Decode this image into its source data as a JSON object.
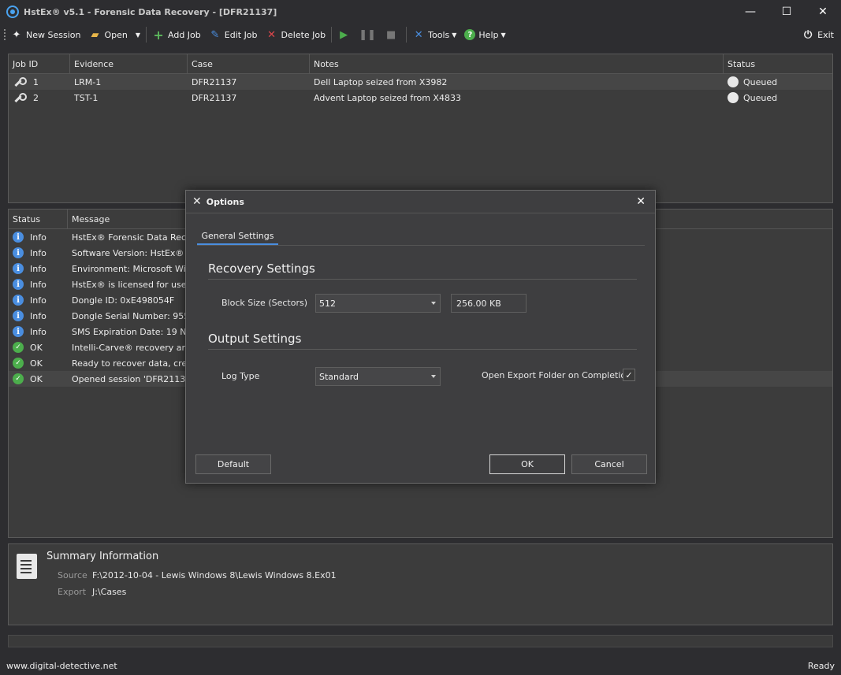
{
  "window": {
    "title": "HstEx® v5.1 - Forensic Data Recovery - [DFR21137]",
    "minimize": "—",
    "maximize": "☐",
    "close": "✕"
  },
  "toolbar": {
    "new_session": "New Session",
    "open": "Open",
    "add_job": "Add Job",
    "edit_job": "Edit Job",
    "delete_job": "Delete Job",
    "tools": "Tools",
    "help": "Help",
    "exit": "Exit"
  },
  "jobs": {
    "columns": [
      "Job ID",
      "Evidence",
      "Case",
      "Notes",
      "Status"
    ],
    "rows": [
      {
        "id": "1",
        "evidence": "LRM-1",
        "case": "DFR21137",
        "notes": "Dell Laptop seized from X3982",
        "status": "Queued"
      },
      {
        "id": "2",
        "evidence": "TST-1",
        "case": "DFR21137",
        "notes": "Advent Laptop seized from X4833",
        "status": "Queued"
      }
    ]
  },
  "log": {
    "columns": [
      "Status",
      "Message"
    ],
    "rows": [
      {
        "status": "Info",
        "message": "HstEx® Forensic Data Recove"
      },
      {
        "status": "Info",
        "message": "Software Version: HstEx® v5"
      },
      {
        "status": "Info",
        "message": "Environment: Microsoft Windo"
      },
      {
        "status": "Info",
        "message": "HstEx® is licensed for use by:"
      },
      {
        "status": "Info",
        "message": "Dongle ID: 0xE498054F"
      },
      {
        "status": "Info",
        "message": "Dongle Serial Number: 95521C"
      },
      {
        "status": "Info",
        "message": "SMS Expiration Date: 19 Nove"
      },
      {
        "status": "OK",
        "message": "Intelli-Carve® recovery and v"
      },
      {
        "status": "OK",
        "message": "Ready to recover data, create"
      },
      {
        "status": "OK",
        "message": "Opened session 'DFR21137'"
      }
    ]
  },
  "summary": {
    "title": "Summary Information",
    "source_label": "Source",
    "source_value": "F:\\2012-10-04 - Lewis Windows 8\\Lewis Windows 8.Ex01",
    "export_label": "Export",
    "export_value": "J:\\Cases"
  },
  "statusbar": {
    "left": "www.digital-detective.net",
    "right": "Ready"
  },
  "dialog": {
    "title": "Options",
    "close": "✕",
    "tab": "General Settings",
    "recovery_heading": "Recovery Settings",
    "block_size_label": "Block Size (Sectors)",
    "block_size_value": "512",
    "block_size_readout": "256.00 KB",
    "output_heading": "Output Settings",
    "log_type_label": "Log Type",
    "log_type_value": "Standard",
    "open_export_label": "Open Export Folder on Completion",
    "open_export_checked": "✓",
    "default_button": "Default",
    "ok_button": "OK",
    "cancel_button": "Cancel"
  },
  "colors": {
    "background": "#2d2d30",
    "panel": "#3c3c3c",
    "accent": "#4a8ee0",
    "ok": "#4cae4c"
  }
}
